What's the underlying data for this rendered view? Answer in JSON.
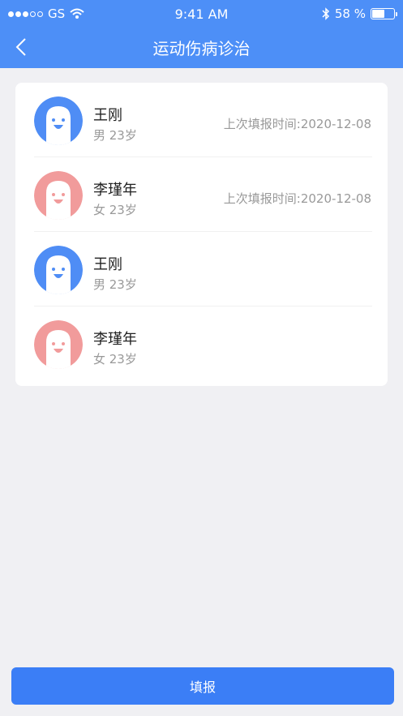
{
  "status": {
    "carrier": "GS",
    "time": "9:41 AM",
    "battery": "58 %"
  },
  "nav": {
    "title": "运动伤病诊治"
  },
  "patients": [
    {
      "name": "王刚",
      "info": "男 23岁",
      "last_report": "上次填报时间:2020-12-08",
      "avatar_color": "#4f8df5"
    },
    {
      "name": "李瑾年",
      "info": "女 23岁",
      "last_report": "上次填报时间:2020-12-08",
      "avatar_color": "#f19b9b"
    },
    {
      "name": "王刚",
      "info": "男 23岁",
      "last_report": "",
      "avatar_color": "#4f8df5"
    },
    {
      "name": "李瑾年",
      "info": "女 23岁",
      "last_report": "",
      "avatar_color": "#f19b9b"
    }
  ],
  "submit_label": "填报",
  "colors": {
    "primary": "#4d8ff7",
    "button": "#3b7ef6",
    "background": "#f0f0f3"
  }
}
